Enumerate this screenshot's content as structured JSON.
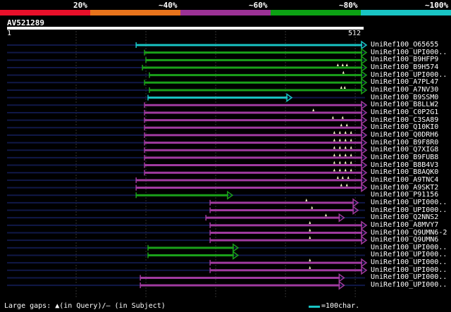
{
  "scale": {
    "labels": [
      "20%",
      "~40%",
      "~60%",
      "~80%",
      "~100%"
    ],
    "colors": [
      "#e8102a",
      "#e8741c",
      "#9c3296",
      "#0ca214",
      "#19c4c4"
    ]
  },
  "query": {
    "name": "AV521289",
    "start": "1",
    "end": "512",
    "length": 512
  },
  "colors": {
    "cyan": "#19c4c4",
    "green": "#1aa01a",
    "purple": "#a03aa0",
    "navy": "#101848",
    "grid": "#333333",
    "gap_marker": "#ffffcc"
  },
  "hits": [
    {
      "name": "UniRef100_O65655",
      "start": 186,
      "end": 512,
      "color": "cyan",
      "gaps": []
    },
    {
      "name": "UniRef100_UPI000..",
      "start": 198,
      "end": 512,
      "color": "green",
      "gaps": []
    },
    {
      "name": "UniRef100_B9HFP9",
      "start": 200,
      "end": 512,
      "color": "green",
      "gaps": []
    },
    {
      "name": "UniRef100_B9H574",
      "start": 195,
      "end": 512,
      "color": "green",
      "gaps": [
        475,
        482,
        488
      ]
    },
    {
      "name": "UniRef100_UPI000..",
      "start": 205,
      "end": 512,
      "color": "green",
      "gaps": [
        483
      ]
    },
    {
      "name": "UniRef100_A7PL47",
      "start": 198,
      "end": 512,
      "color": "green",
      "gaps": []
    },
    {
      "name": "UniRef100_A7NV30",
      "start": 205,
      "end": 512,
      "color": "green",
      "gaps": [
        480,
        485
      ]
    },
    {
      "name": "UniRef100_B9SSM0",
      "start": 203,
      "end": 405,
      "color": "cyan",
      "gaps": []
    },
    {
      "name": "UniRef100_B8LLW2",
      "start": 198,
      "end": 512,
      "color": "purple",
      "gaps": []
    },
    {
      "name": "UniRef100_C0P2G1",
      "start": 198,
      "end": 512,
      "color": "purple",
      "gaps": [
        440
      ]
    },
    {
      "name": "UniRef100_C3SA89",
      "start": 198,
      "end": 512,
      "color": "purple",
      "gaps": [
        468,
        482
      ]
    },
    {
      "name": "UniRef100_Q10KI0",
      "start": 198,
      "end": 512,
      "color": "purple",
      "gaps": [
        480,
        488
      ]
    },
    {
      "name": "UniRef100_Q0DRH6",
      "start": 198,
      "end": 512,
      "color": "purple",
      "gaps": [
        470,
        478,
        486,
        494
      ]
    },
    {
      "name": "UniRef100_B9F8R0",
      "start": 198,
      "end": 512,
      "color": "purple",
      "gaps": [
        470,
        478,
        486,
        494
      ]
    },
    {
      "name": "UniRef100_Q7XIG8",
      "start": 198,
      "end": 512,
      "color": "purple",
      "gaps": [
        470,
        478,
        486,
        494
      ]
    },
    {
      "name": "UniRef100_B9FUB8",
      "start": 198,
      "end": 512,
      "color": "purple",
      "gaps": [
        470,
        478,
        486,
        494
      ]
    },
    {
      "name": "UniRef100_B8B4V3",
      "start": 198,
      "end": 512,
      "color": "purple",
      "gaps": [
        470,
        478,
        486,
        494
      ]
    },
    {
      "name": "UniRef100_B8AQK0",
      "start": 198,
      "end": 512,
      "color": "purple",
      "gaps": [
        470,
        478,
        486,
        494
      ]
    },
    {
      "name": "UniRef100_A9TNC4",
      "start": 186,
      "end": 512,
      "color": "purple",
      "gaps": [
        475,
        482,
        490
      ]
    },
    {
      "name": "UniRef100_A9SKT2",
      "start": 186,
      "end": 512,
      "color": "purple",
      "gaps": [
        480,
        488
      ]
    },
    {
      "name": "UniRef100_P91156",
      "start": 186,
      "end": 320,
      "color": "green",
      "gaps": []
    },
    {
      "name": "UniRef100_UPI000..",
      "start": 292,
      "end": 500,
      "color": "purple",
      "gaps": [
        430
      ]
    },
    {
      "name": "UniRef100_UPI000..",
      "start": 292,
      "end": 500,
      "color": "purple",
      "gaps": [
        438
      ]
    },
    {
      "name": "UniRef100_Q2NNS2",
      "start": 286,
      "end": 480,
      "color": "purple",
      "gaps": [
        458
      ]
    },
    {
      "name": "UniRef100_A8MVY7",
      "start": 292,
      "end": 512,
      "color": "purple",
      "gaps": [
        435
      ]
    },
    {
      "name": "UniRef100_Q9UMN6-2",
      "start": 292,
      "end": 512,
      "color": "purple",
      "gaps": [
        435
      ]
    },
    {
      "name": "UniRef100_Q9UMN6",
      "start": 292,
      "end": 512,
      "color": "purple",
      "gaps": [
        435
      ]
    },
    {
      "name": "UniRef100_UPI000..",
      "start": 203,
      "end": 328,
      "color": "green",
      "gaps": []
    },
    {
      "name": "UniRef100_UPI000..",
      "start": 203,
      "end": 328,
      "color": "green",
      "gaps": []
    },
    {
      "name": "UniRef100_UPI000..",
      "start": 292,
      "end": 512,
      "color": "purple",
      "gaps": [
        435
      ]
    },
    {
      "name": "UniRef100_UPI000..",
      "start": 292,
      "end": 512,
      "color": "purple",
      "gaps": [
        435
      ]
    },
    {
      "name": "UniRef100_UPI000..",
      "start": 192,
      "end": 480,
      "color": "purple",
      "gaps": []
    },
    {
      "name": "UniRef100_UPI000..",
      "start": 192,
      "end": 480,
      "color": "purple",
      "gaps": []
    }
  ],
  "footer": {
    "text": "Large gaps: ▲(in Query)/– (in Subject)",
    "legend": "=100char."
  }
}
